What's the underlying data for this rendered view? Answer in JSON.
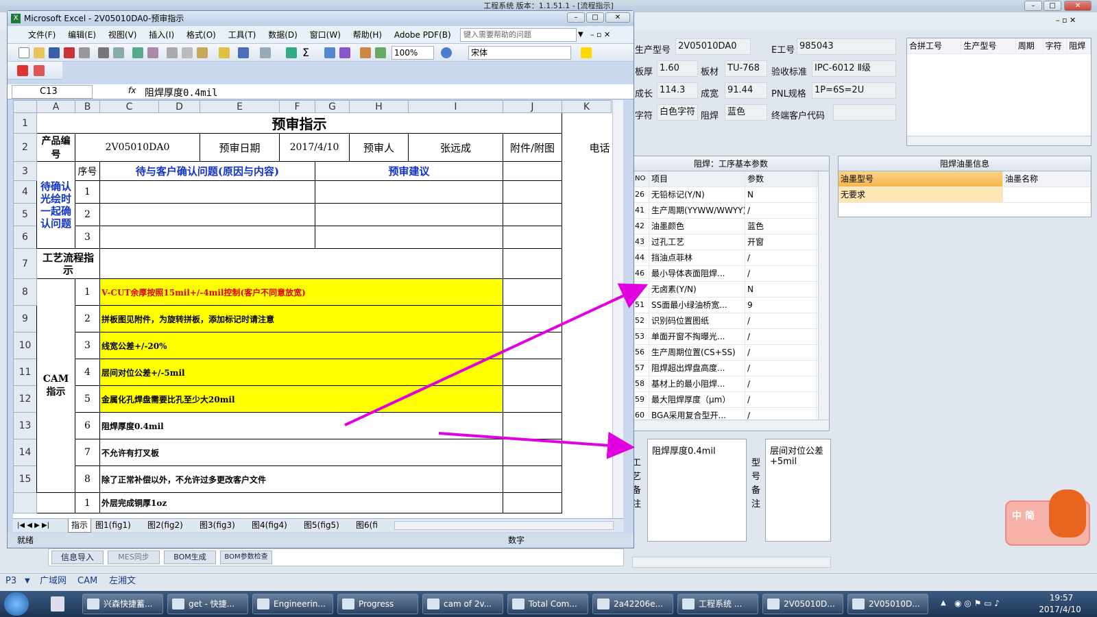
{
  "bgapp": {
    "title": "工程系统   版本：1.1.51.1 - [流程指示]",
    "fields": [
      {
        "label": "生产型号",
        "value": "2V05010DA0"
      },
      {
        "label": "E工号",
        "value": "985043"
      },
      {
        "label": "板厚",
        "value": "1.60"
      },
      {
        "label": "板材",
        "value": "TU-768"
      },
      {
        "label": "验收标准",
        "value": "IPC-6012 Ⅱ级"
      },
      {
        "label": "成长",
        "value": "114.3"
      },
      {
        "label": "成宽",
        "value": "91.44"
      },
      {
        "label": "PNL规格",
        "value": "1P=6S=2U"
      },
      {
        "label": "字符",
        "value": "白色字符"
      },
      {
        "label": "阻焊",
        "value": "蓝色"
      },
      {
        "label": "终端客户代码",
        "value": ""
      }
    ],
    "merge_table": {
      "headers": [
        "合拼工号",
        "生产型号",
        "周期",
        "字符",
        "阻焊"
      ]
    },
    "param_panel": {
      "title": "阻焊：工序基本参数",
      "headers": [
        "NO",
        "项目",
        "参数"
      ],
      "rows": [
        [
          "26",
          "无铅标记(Y/N)",
          "N"
        ],
        [
          "41",
          "生产周期(YYWW/WWYY)",
          "/"
        ],
        [
          "42",
          "油墨颜色",
          "蓝色"
        ],
        [
          "43",
          "过孔工艺",
          "开窗"
        ],
        [
          "44",
          "挡油点菲林",
          "/"
        ],
        [
          "46",
          "最小导体表面阻焊...",
          "/"
        ],
        [
          "47",
          "无卤素(Y/N)",
          "N"
        ],
        [
          "51",
          "SS面最小绿油桥宽...",
          "9"
        ],
        [
          "52",
          "识别码位置图纸",
          "/"
        ],
        [
          "53",
          "单面开窗不掏曝光...",
          "/"
        ],
        [
          "56",
          "生产周期位置(CS+SS)",
          "/"
        ],
        [
          "57",
          "阻焊超出焊盘高度...",
          "/"
        ],
        [
          "58",
          "基材上的最小阻焊...",
          "/"
        ],
        [
          "59",
          "最大阻焊厚度（μm）",
          "/"
        ],
        [
          "60",
          "BGA采用复合型开...",
          "/"
        ]
      ]
    },
    "ink_panel": {
      "title": "阻焊油墨信息",
      "headers": [
        "油墨型号",
        "油墨名称"
      ],
      "rows": [
        [
          "无要求",
          ""
        ]
      ]
    },
    "remark_process": {
      "label": "工艺备注",
      "text": "阻焊厚度0.4mil"
    },
    "remark_model": {
      "label": "型号备注",
      "text": "层间对位公差+5mil"
    },
    "bottom_tabs": [
      "信息导入",
      "MES同步",
      "BOM生成",
      "BOM参数检查"
    ],
    "bottom_bar": [
      "P3",
      "广域网",
      "CAM",
      "左湘文"
    ]
  },
  "excel": {
    "title": "Microsoft Excel - 2V05010DA0-预审指示",
    "menu": [
      "文件(F)",
      "编辑(E)",
      "视图(V)",
      "插入(I)",
      "格式(O)",
      "工具(T)",
      "数据(D)",
      "窗口(W)",
      "帮助(H)",
      "Adobe PDF(B)"
    ],
    "help_placeholder": "键入需要帮助的问题",
    "zoom": "100%",
    "font": "宋体",
    "namebox": "C13",
    "fx": "fx",
    "formula": "阻焊厚度0.4mil",
    "cols": [
      "A",
      "B",
      "C",
      "D",
      "E",
      "F",
      "G",
      "H",
      "I",
      "J",
      "K"
    ],
    "sheet": {
      "title": "预审指示",
      "product_label": "产品编号",
      "product_value": "2V05010DA0",
      "date_label": "预审日期",
      "date_value": "2017/4/10",
      "reviewer_label": "预审人",
      "reviewer_value": "张远成",
      "attach_label": "附件/附图",
      "phone_label": "电话",
      "seq_label": "序号",
      "question_label": "待与客户确认问题(原因与内容)",
      "suggest_label": "预审建议",
      "pending_label": "待确认光绘时一起确认问题",
      "process_label": "工艺流程指示",
      "cam_label": "CAM指示",
      "cam_items": [
        "V-CUT余厚按照15mil+/-4mil控制(客户不同意放宽)",
        "拼板图见附件，为旋转拼板，添加标记时请注意",
        "线宽公差+/-20%",
        "层间对位公差+/-5mil",
        "金属化孔焊盘需要比孔至少大20mil",
        "阻焊厚度0.4mil",
        "不允许有打叉板",
        "除了正常补偿以外，不允许过多更改客户文件"
      ],
      "last_item": "外层完成铜厚1oz"
    },
    "tabs": [
      "指示",
      "图1(fig1)",
      "图2(fig2)",
      "图3(fig3)",
      "图4(fig4)",
      "图5(fig5)",
      "图6(fi"
    ],
    "status": "就绪",
    "status_right": "数字"
  },
  "taskbar": {
    "items": [
      "兴森快捷蓄...",
      "get - 快捷...",
      "Engineerin...",
      "Progress",
      "cam of 2v...",
      "Total Com...",
      "2a42206e...",
      "工程系统  ...",
      "2V05010D...",
      "2V05010D..."
    ],
    "time": "19:57",
    "date": "2017/4/10"
  },
  "ime": {
    "text": "中 简"
  },
  "colors": {
    "highlight": "#ffff00",
    "arrow": "#e000e0",
    "blue_text": "#1133cc",
    "red_text": "#dd0000"
  }
}
